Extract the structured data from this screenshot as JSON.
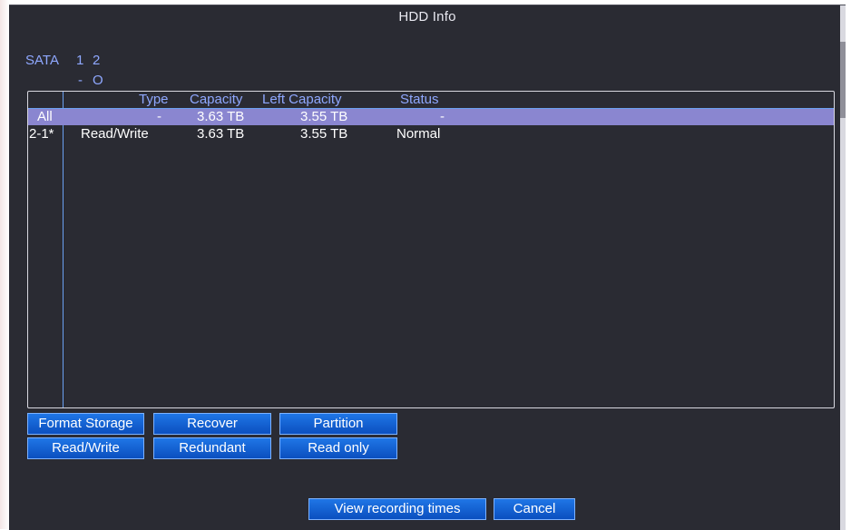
{
  "window": {
    "title": "HDD Info"
  },
  "sata": {
    "label": "SATA",
    "ports": [
      "1",
      "2"
    ],
    "states": [
      "-",
      "O"
    ]
  },
  "table": {
    "columns": [
      "Type",
      "Capacity",
      "Left Capacity",
      "Status"
    ],
    "rows": [
      {
        "id": "All",
        "type": "-",
        "capacity": "3.63 TB",
        "left": "3.55 TB",
        "status": "-"
      },
      {
        "id": "2-1*",
        "type": "Read/Write",
        "capacity": "3.63 TB",
        "left": "3.55 TB",
        "status": "Normal"
      }
    ]
  },
  "buttons": {
    "format_storage": "Format Storage",
    "recover": "Recover",
    "partition": "Partition",
    "read_write": "Read/Write",
    "redundant": "Redundant",
    "read_only": "Read only",
    "view_recording_times": "View recording times",
    "cancel": "Cancel"
  },
  "colors": {
    "background": "#2a2b33",
    "header_text": "#8fa8ff",
    "selected_row": "#8a86d0",
    "button": "#0b5fd6"
  }
}
